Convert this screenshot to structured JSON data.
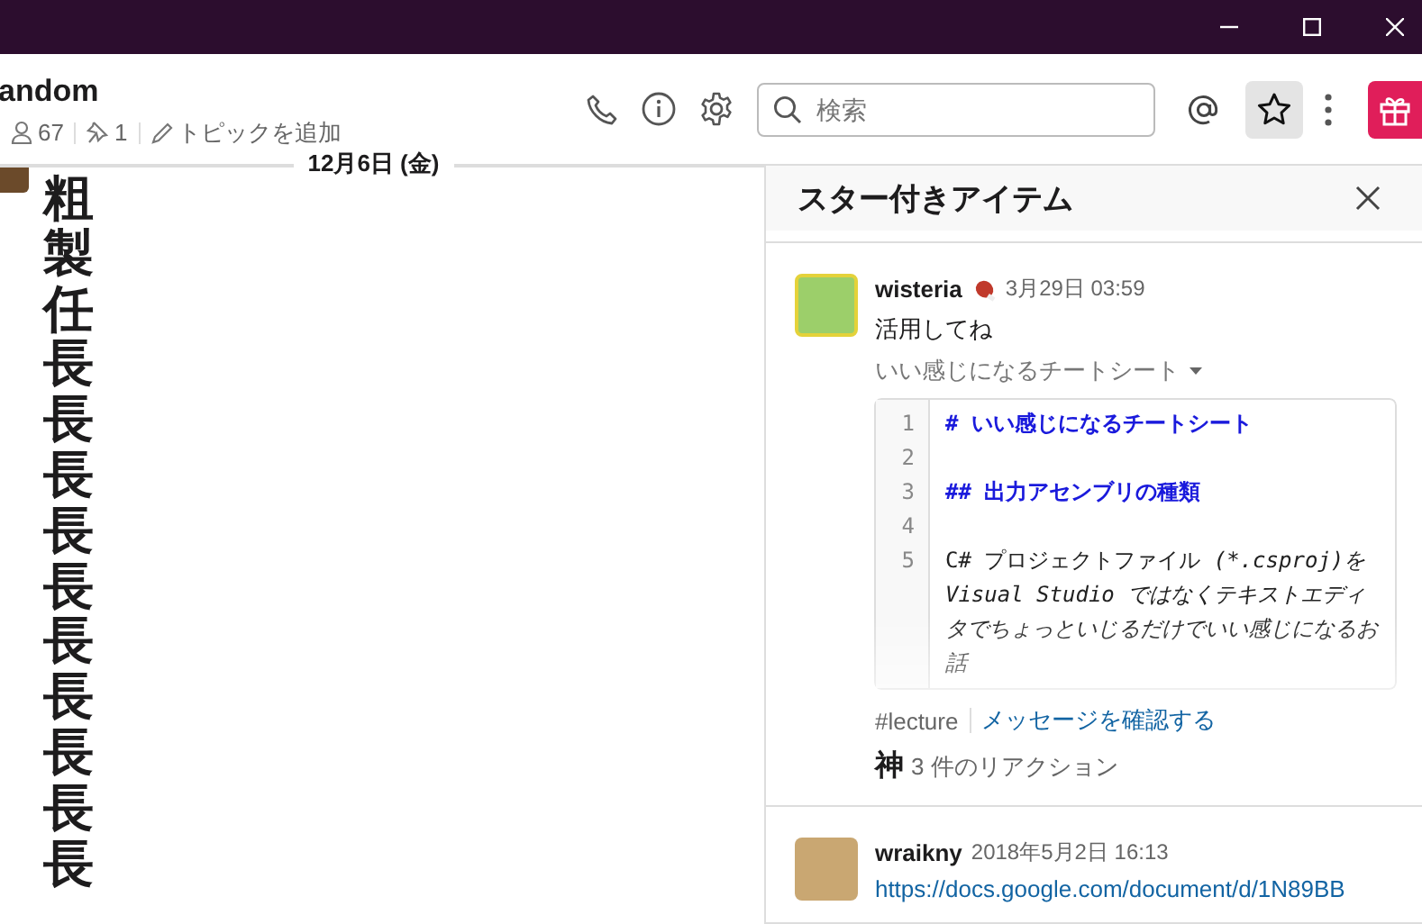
{
  "channel": {
    "name": "andom",
    "members": "67",
    "pins": "1",
    "topic_action": "トピックを追加"
  },
  "toolbar": {
    "search": {
      "placeholder": "検索"
    },
    "starred": {
      "selected": true
    }
  },
  "date_divider": "12月6日 (金)",
  "message": {
    "text": "粗製任長長長長長長長長長長"
  },
  "panel": {
    "title": "スター付きアイテム",
    "items": [
      {
        "kind": "file",
        "author": "wisteria",
        "time": "3月29日 03:59",
        "text": "活用してね",
        "file_title": "いい感じになるチートシート",
        "code_lines": [
          {
            "number": "1",
            "kind": "heading",
            "text": "# いい感じになるチートシート"
          },
          {
            "number": "2",
            "kind": "blank"
          },
          {
            "number": "3",
            "kind": "heading",
            "text": "## 出力アセンブリの種類"
          },
          {
            "number": "4",
            "kind": "blank"
          },
          {
            "number": "5",
            "kind": "plain",
            "segments": [
              {
                "kind": "normal",
                "text": "C# プロジェクトファイル "
              },
              {
                "kind": "emphasis",
                "text": "(*.csproj)を Visual Studio ではなくテキストエディタでちょっといじるだけでいい感じになるお話"
              }
            ]
          }
        ],
        "channel": "#lecture",
        "link": "メッセージを確認する",
        "reaction_emoji": "神",
        "reaction_text": "3 件のリアクション"
      },
      {
        "kind": "link",
        "author": "wraikny",
        "time": "2018年5月2日 16:13",
        "text": "https://docs.google.com/document/d/1N89BB"
      }
    ]
  }
}
